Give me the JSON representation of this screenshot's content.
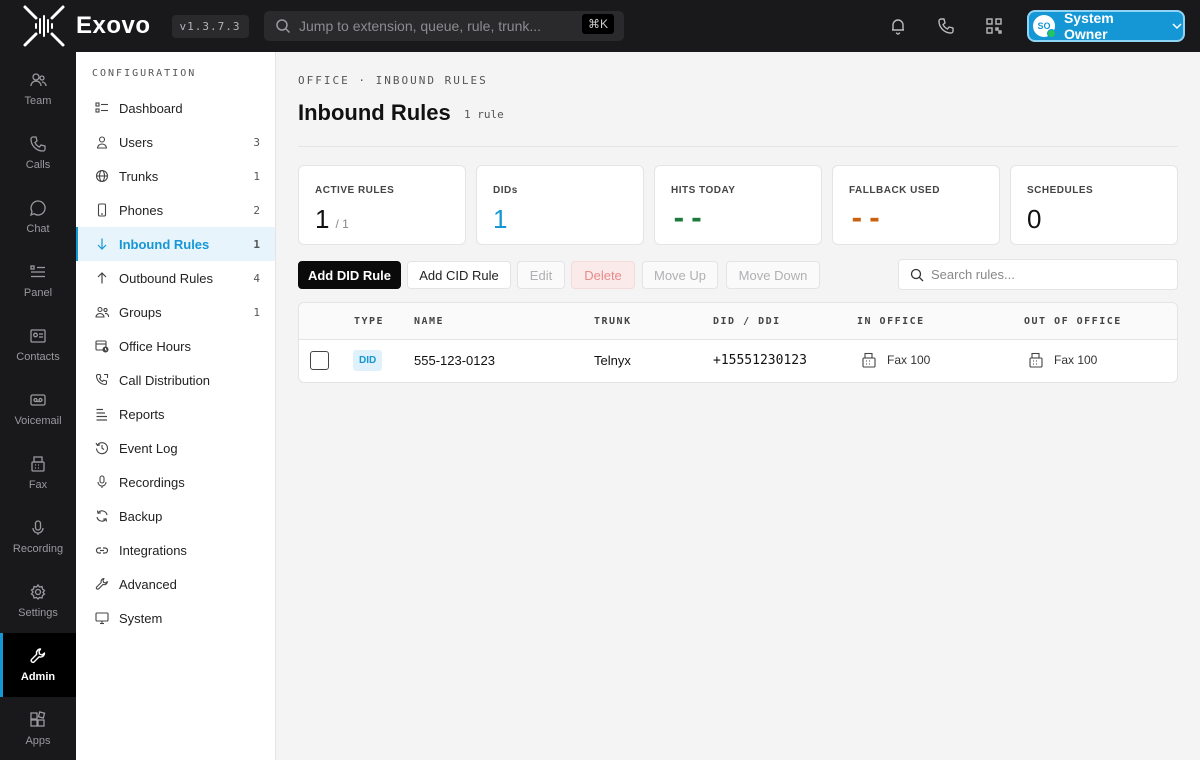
{
  "app": {
    "name": "Exovo",
    "version": "v1.3.7.3"
  },
  "top": {
    "search_placeholder": "Jump to extension, queue, rule, trunk...",
    "shortcut": "⌘K",
    "user_initials": "SO",
    "user_name": "System Owner"
  },
  "rail": {
    "items": [
      {
        "label": "Team"
      },
      {
        "label": "Calls"
      },
      {
        "label": "Chat"
      },
      {
        "label": "Panel"
      },
      {
        "label": "Contacts"
      },
      {
        "label": "Voicemail"
      },
      {
        "label": "Fax"
      },
      {
        "label": "Recording"
      },
      {
        "label": "Settings"
      },
      {
        "label": "Admin"
      },
      {
        "label": "Apps"
      }
    ]
  },
  "sidebar": {
    "title": "CONFIGURATION",
    "items": [
      {
        "label": "Dashboard",
        "count": ""
      },
      {
        "label": "Users",
        "count": "3"
      },
      {
        "label": "Trunks",
        "count": "1"
      },
      {
        "label": "Phones",
        "count": "2"
      },
      {
        "label": "Inbound Rules",
        "count": "1"
      },
      {
        "label": "Outbound Rules",
        "count": "4"
      },
      {
        "label": "Groups",
        "count": "1"
      },
      {
        "label": "Office Hours",
        "count": ""
      },
      {
        "label": "Call Distribution",
        "count": ""
      },
      {
        "label": "Reports",
        "count": ""
      },
      {
        "label": "Event Log",
        "count": ""
      },
      {
        "label": "Recordings",
        "count": ""
      },
      {
        "label": "Backup",
        "count": ""
      },
      {
        "label": "Integrations",
        "count": ""
      },
      {
        "label": "Advanced",
        "count": ""
      },
      {
        "label": "System",
        "count": ""
      }
    ]
  },
  "main": {
    "breadcrumb": "OFFICE · INBOUND RULES",
    "title": "Inbound Rules",
    "rule_count": "1 rule",
    "stats": [
      {
        "label": "ACTIVE RULES",
        "value": "1",
        "sub": "/ 1"
      },
      {
        "label": "DIDs",
        "value": "1",
        "sub": ""
      },
      {
        "label": "HITS TODAY",
        "value": "--",
        "sub": ""
      },
      {
        "label": "FALLBACK USED",
        "value": "--",
        "sub": ""
      },
      {
        "label": "SCHEDULES",
        "value": "0",
        "sub": ""
      }
    ],
    "buttons": {
      "add_did": "Add DID Rule",
      "add_cid": "Add CID Rule",
      "edit": "Edit",
      "delete": "Delete",
      "move_up": "Move Up",
      "move_down": "Move Down"
    },
    "search_placeholder": "Search rules...",
    "columns": [
      "TYPE",
      "NAME",
      "TRUNK",
      "DID / DDI",
      "IN OFFICE",
      "OUT OF OFFICE"
    ],
    "rows": [
      {
        "type": "DID",
        "name": "555-123-0123",
        "trunk": "Telnyx",
        "did": "+15551230123",
        "in_office": "Fax 100",
        "out_of_office": "Fax 100"
      }
    ]
  },
  "colors": {
    "accent": "#1597d5",
    "green": "#1e7a3c",
    "orange": "#c9620e",
    "dark": "#19191b"
  }
}
